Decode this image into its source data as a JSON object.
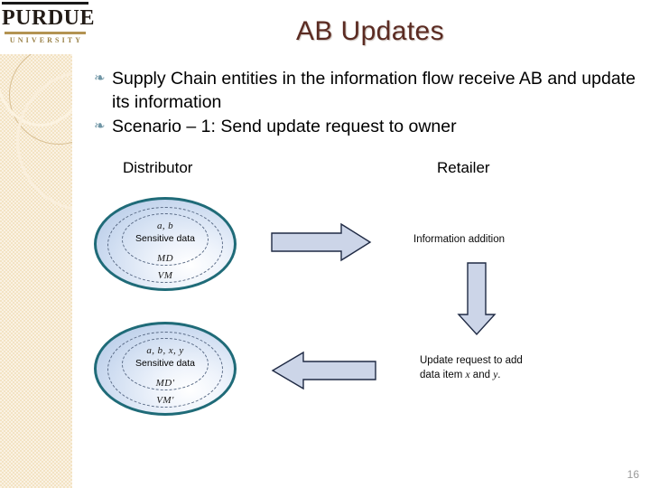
{
  "slide": {
    "title": "AB Updates",
    "page_number": "16",
    "accent_color": "#5b2b22",
    "band_color": "#f3e3c3",
    "ellipse_border_color": "#1f6b78",
    "arrow_fill_color": "#ccd5e8",
    "arrow_stroke_color": "#1f2a44"
  },
  "logo": {
    "wordmark": "PURDUE",
    "subword": "UNIVERSITY"
  },
  "bullets": [
    {
      "glyph": "❧",
      "text": "Supply Chain entities in the information flow receive AB and update its information"
    },
    {
      "glyph": "❧",
      "text": "Scenario – 1: Send update request to owner"
    }
  ],
  "diagram": {
    "headings": {
      "distributor": "Distributor",
      "retailer": "Retailer"
    },
    "entities": [
      {
        "name": "distributor-state-before",
        "data_label": "a, b",
        "sensitive_label": "Sensitive data",
        "md_label": "MD",
        "vm_label": "VM"
      },
      {
        "name": "distributor-state-after",
        "data_label": "a, b, x, y",
        "sensitive_label": "Sensitive data",
        "md_label": "MD'",
        "vm_label": "VM'"
      }
    ],
    "arrows": [
      {
        "name": "arrow-right",
        "direction": "right"
      },
      {
        "name": "arrow-down",
        "direction": "down"
      },
      {
        "name": "arrow-left",
        "direction": "left"
      }
    ],
    "notes": {
      "information_addition": "Information addition",
      "update_request_line1_prefix": "Update request to add",
      "update_request_line2_prefix": "data item ",
      "update_request_var_x": "x",
      "update_request_mid": " and ",
      "update_request_var_y": "y",
      "update_request_suffix": "."
    }
  }
}
